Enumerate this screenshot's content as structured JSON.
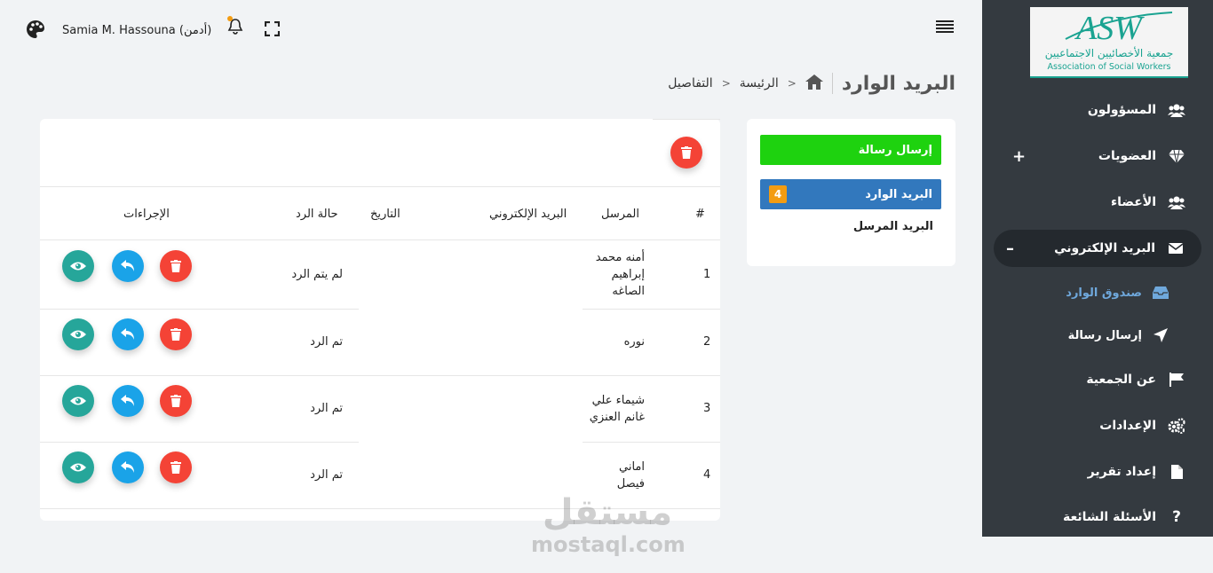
{
  "logo": {
    "brand": "ASW",
    "arabic": "جمعية الأخصائيين الاجتماعيين",
    "english": "Association of Social Workers"
  },
  "sidebar": {
    "items": [
      {
        "label": "المسؤولون",
        "icon": "users-icon"
      },
      {
        "label": "العضويات",
        "icon": "diamond-icon",
        "toggle": "+"
      },
      {
        "label": "الأعضاء",
        "icon": "users-icon"
      },
      {
        "label": "البريد الإلكتروني",
        "icon": "envelope-icon",
        "toggle": "–"
      },
      {
        "label": "عن الجمعية",
        "icon": "flag-icon"
      },
      {
        "label": "الإعدادات",
        "icon": "cogs-icon"
      },
      {
        "label": "إعداد تقرير",
        "icon": "file-icon"
      },
      {
        "label": "الأسئلة الشائعة",
        "icon": "question-icon"
      }
    ],
    "sub_items": [
      {
        "label": "صندوق الوارد",
        "icon": "inbox-icon"
      },
      {
        "label": "إرسال رسالة",
        "icon": "paper-plane-icon"
      }
    ]
  },
  "topbar": {
    "user": "Samia M. Hassouna (أدمن)"
  },
  "page": {
    "title": "البريد الوارد",
    "breadcrumb": [
      "الرئيسة",
      "التفاصيل"
    ]
  },
  "mailbox": {
    "send_label": "إرسال رسالة",
    "inbox_label": "البريد الوارد",
    "inbox_count": "4",
    "sent_label": "البريد المرسل"
  },
  "table": {
    "headers": {
      "num": "#",
      "sender": "المرسل",
      "email": "البريد الإلكتروني",
      "date": "التاريخ",
      "status": "حالة الرد",
      "actions": "الإجراءات"
    },
    "rows": [
      {
        "num": "1",
        "sender": [
          "أمنه محمد",
          "إبراهيم",
          "الصاغه"
        ],
        "status": "لم يتم الرد"
      },
      {
        "num": "2",
        "sender": [
          "نوره"
        ],
        "status": "تم الرد"
      },
      {
        "num": "3",
        "sender": [
          "شيماء علي",
          "غانم العنزي"
        ],
        "status": "تم الرد"
      },
      {
        "num": "4",
        "sender": [
          "اماني",
          "فيصل"
        ],
        "status": "تم الرد"
      }
    ]
  },
  "watermark": {
    "arabic": "مستقل",
    "latin": "mostaql.com"
  },
  "colors": {
    "sidebar": "#343a40",
    "green": "#1ed20f",
    "blue": "#3278bd",
    "badge": "#f39c12",
    "red": "#f44336",
    "cyan": "#1aa3e8",
    "teal": "#26a69a"
  }
}
